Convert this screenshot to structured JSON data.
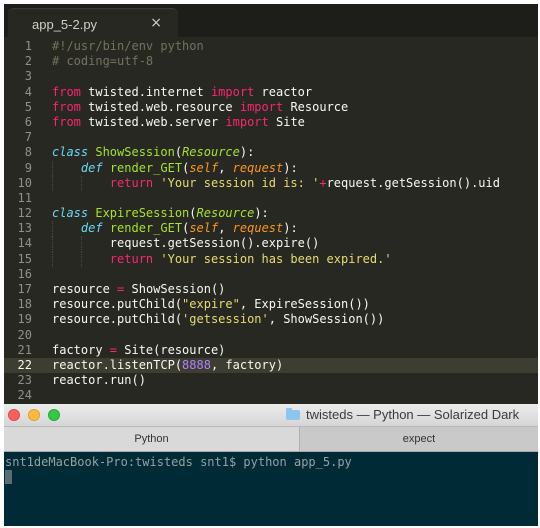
{
  "editor": {
    "tab_title": "app_5-2.py",
    "close_glyph": "×",
    "current_line": 22
  },
  "code_lines": [
    {
      "n": "1",
      "t": [
        [
          "c",
          "#!/usr/bin/env python"
        ]
      ]
    },
    {
      "n": "2",
      "t": [
        [
          "c",
          "# coding=utf-8"
        ]
      ]
    },
    {
      "n": "3",
      "t": []
    },
    {
      "n": "4",
      "t": [
        [
          "k",
          "from"
        ],
        [
          "d",
          " twisted.internet "
        ],
        [
          "k",
          "import"
        ],
        [
          "d",
          " reactor"
        ]
      ]
    },
    {
      "n": "5",
      "t": [
        [
          "k",
          "from"
        ],
        [
          "d",
          " twisted.web.resource "
        ],
        [
          "k",
          "import"
        ],
        [
          "d",
          " Resource"
        ]
      ]
    },
    {
      "n": "6",
      "t": [
        [
          "k",
          "from"
        ],
        [
          "d",
          " twisted.web.server "
        ],
        [
          "k",
          "import"
        ],
        [
          "d",
          " Site"
        ]
      ]
    },
    {
      "n": "7",
      "t": []
    },
    {
      "n": "8",
      "t": [
        [
          "b",
          "class"
        ],
        [
          "d",
          " "
        ],
        [
          "f",
          "ShowSession"
        ],
        [
          "d",
          "("
        ],
        [
          "i",
          "Resource"
        ],
        [
          "d",
          "):"
        ]
      ]
    },
    {
      "n": "9",
      "t": [
        [
          "d",
          "    "
        ],
        [
          "b",
          "def"
        ],
        [
          "d",
          " "
        ],
        [
          "f",
          "render_GET"
        ],
        [
          "d",
          "("
        ],
        [
          "p",
          "self"
        ],
        [
          "d",
          ", "
        ],
        [
          "p",
          "request"
        ],
        [
          "d",
          "):"
        ]
      ]
    },
    {
      "n": "10",
      "t": [
        [
          "d",
          "        "
        ],
        [
          "k",
          "return"
        ],
        [
          "d",
          " "
        ],
        [
          "s",
          "'Your session id is: '"
        ],
        [
          "k",
          "+"
        ],
        [
          "d",
          "request.getSession().uid"
        ]
      ]
    },
    {
      "n": "11",
      "t": []
    },
    {
      "n": "12",
      "t": [
        [
          "b",
          "class"
        ],
        [
          "d",
          " "
        ],
        [
          "f",
          "ExpireSession"
        ],
        [
          "d",
          "("
        ],
        [
          "i",
          "Resource"
        ],
        [
          "d",
          "):"
        ]
      ]
    },
    {
      "n": "13",
      "t": [
        [
          "d",
          "    "
        ],
        [
          "b",
          "def"
        ],
        [
          "d",
          " "
        ],
        [
          "f",
          "render_GET"
        ],
        [
          "d",
          "("
        ],
        [
          "p",
          "self"
        ],
        [
          "d",
          ", "
        ],
        [
          "p",
          "request"
        ],
        [
          "d",
          "):"
        ]
      ]
    },
    {
      "n": "14",
      "t": [
        [
          "d",
          "        request.getSession().expire()"
        ]
      ]
    },
    {
      "n": "15",
      "t": [
        [
          "d",
          "        "
        ],
        [
          "k",
          "return"
        ],
        [
          "d",
          " "
        ],
        [
          "s",
          "'Your session has been expired.'"
        ]
      ]
    },
    {
      "n": "16",
      "t": []
    },
    {
      "n": "17",
      "t": [
        [
          "d",
          "resource "
        ],
        [
          "k",
          "="
        ],
        [
          "d",
          " ShowSession()"
        ]
      ]
    },
    {
      "n": "18",
      "t": [
        [
          "d",
          "resource.putChild("
        ],
        [
          "s",
          "\"expire\""
        ],
        [
          "d",
          ", ExpireSession())"
        ]
      ]
    },
    {
      "n": "19",
      "t": [
        [
          "d",
          "resource.putChild("
        ],
        [
          "s",
          "'getsession'"
        ],
        [
          "d",
          ", ShowSession())"
        ]
      ]
    },
    {
      "n": "20",
      "t": []
    },
    {
      "n": "21",
      "t": [
        [
          "d",
          "factory "
        ],
        [
          "k",
          "="
        ],
        [
          "d",
          " Site(resource)"
        ]
      ]
    },
    {
      "n": "22",
      "t": [
        [
          "d",
          "reactor.listenTCP("
        ],
        [
          "n",
          "8888"
        ],
        [
          "d",
          ", factory)"
        ]
      ]
    },
    {
      "n": "23",
      "t": [
        [
          "d",
          "reactor.run()"
        ]
      ]
    },
    {
      "n": "24",
      "t": []
    }
  ],
  "terminal": {
    "window_title": "twisteds — Python — Solarized Dark",
    "tabs": [
      {
        "label": "Python"
      },
      {
        "label": "expect"
      }
    ],
    "prompt_line": "snt1deMacBook-Pro:twisteds snt1$ python app_5.py"
  }
}
